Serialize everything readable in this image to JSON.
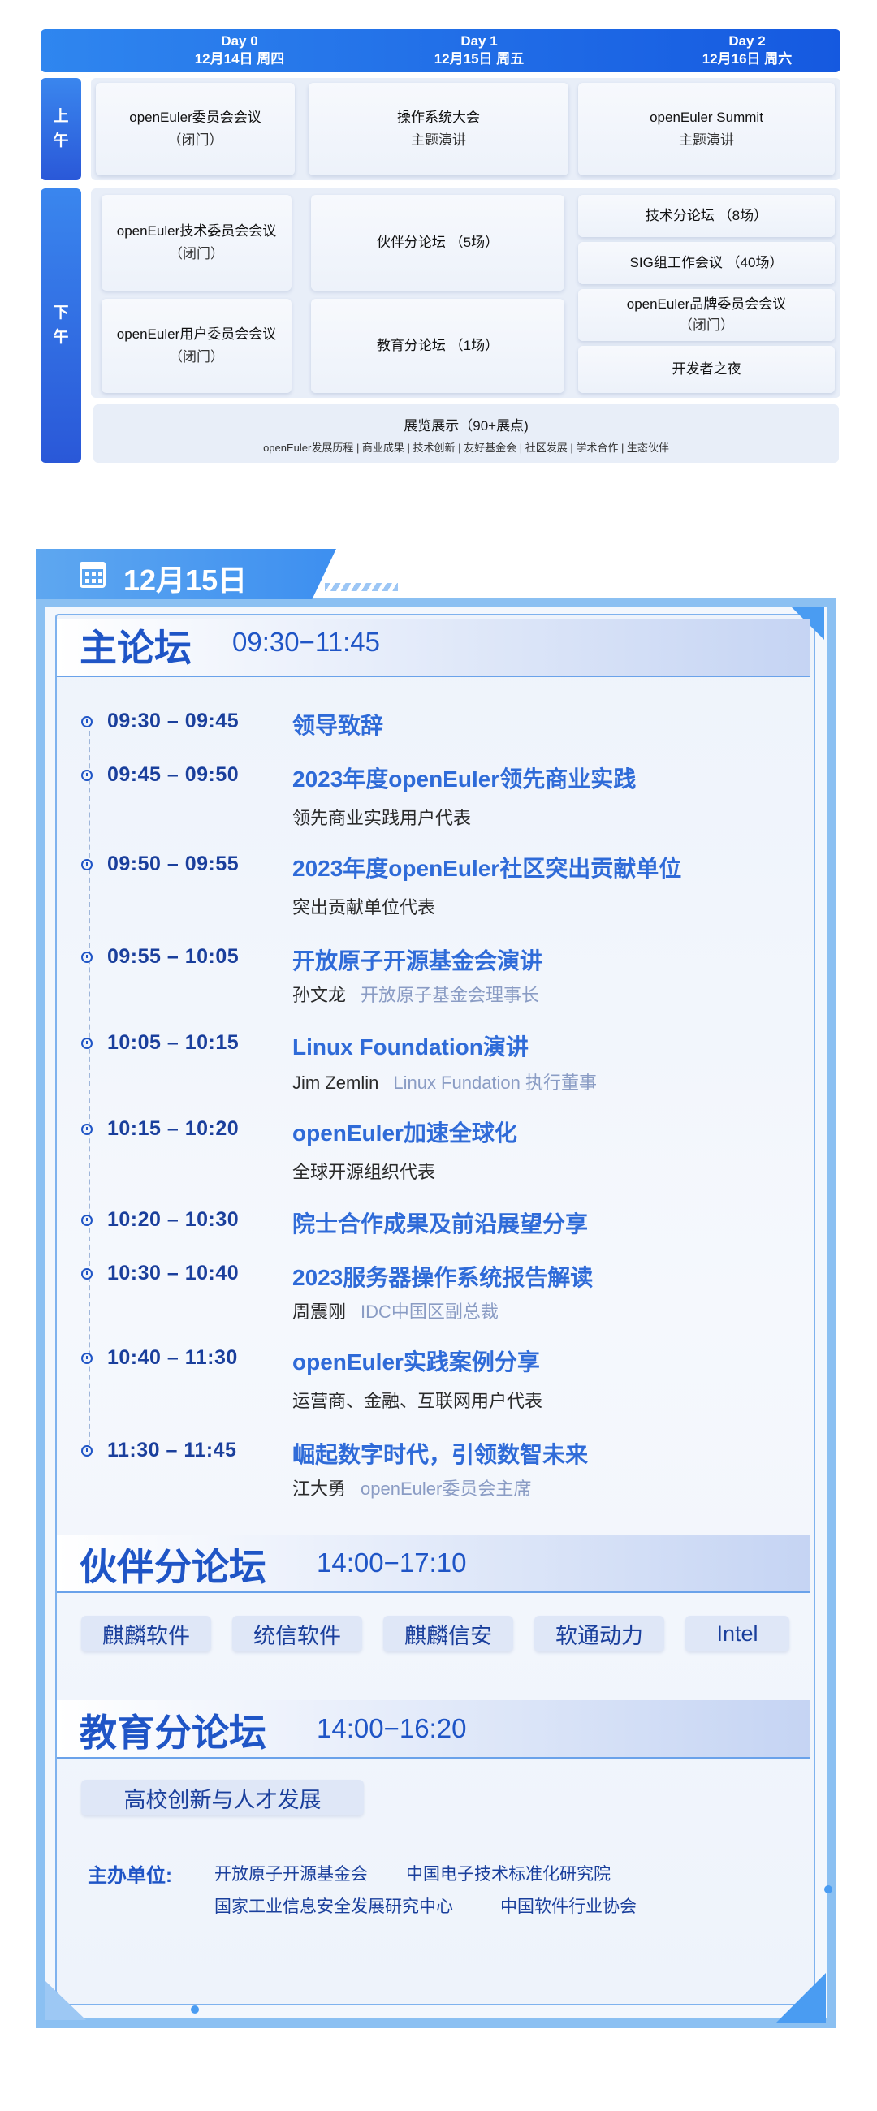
{
  "grid": {
    "days": [
      {
        "day": "Day 0",
        "date": "12月14日  周四"
      },
      {
        "day": "Day 1",
        "date": "12月15日  周五"
      },
      {
        "day": "Day 2",
        "date": "12月16日  周六"
      }
    ],
    "morning_label": "上\n午",
    "morning_label_chars": [
      "上",
      "午"
    ],
    "afternoon_label_chars": [
      "下",
      "午"
    ],
    "morning": [
      {
        "title": "openEuler委员会会议",
        "sub": "（闭门）"
      },
      {
        "title": "操作系统大会",
        "sub": "主题演讲"
      },
      {
        "title": "openEuler Summit",
        "sub": "主题演讲"
      }
    ],
    "afternoon_day0": [
      {
        "title": "openEuler技术委员会会议",
        "sub": "（闭门）"
      },
      {
        "title": "openEuler用户委员会会议",
        "sub": "（闭门）"
      }
    ],
    "afternoon_day1": [
      {
        "title": "伙伴分论坛 （5场）"
      },
      {
        "title": "教育分论坛 （1场）"
      }
    ],
    "afternoon_day2": [
      {
        "title": "技术分论坛 （8场）"
      },
      {
        "title": "SIG组工作会议 （40场）"
      },
      {
        "title": "openEuler品牌委员会会议",
        "sub": "（闭门）"
      },
      {
        "title": "开发者之夜"
      }
    ],
    "expo": {
      "title": "展览展示（90+展点)",
      "items": "openEuler发展历程 | 商业成果 | 技术创新 | 友好基金会 | 社区发展 | 学术合作 | 生态伙伴"
    }
  },
  "agenda": {
    "date": "12月15日",
    "main_forum": {
      "title": "主论坛",
      "time": "09:30−11:45"
    },
    "items": [
      {
        "time": "09:30 – 09:45",
        "title": "领导致辞",
        "speaker": "",
        "role": ""
      },
      {
        "time": "09:45 – 09:50",
        "title": "2023年度openEuler领先商业实践",
        "speaker": "领先商业实践用户代表",
        "role": ""
      },
      {
        "time": "09:50 – 09:55",
        "title": "2023年度openEuler社区突出贡献单位",
        "speaker": "突出贡献单位代表",
        "role": ""
      },
      {
        "time": "09:55 – 10:05",
        "title": "开放原子开源基金会演讲",
        "speaker": "孙文龙",
        "role": "开放原子基金会理事长"
      },
      {
        "time": "10:05 – 10:15",
        "title": "Linux Foundation演讲",
        "speaker": "Jim Zemlin",
        "role": "Linux Fundation 执行董事"
      },
      {
        "time": "10:15 – 10:20",
        "title": "openEuler加速全球化",
        "speaker": "全球开源组织代表",
        "role": ""
      },
      {
        "time": "10:20 – 10:30",
        "title": "院士合作成果及前沿展望分享",
        "speaker": "",
        "role": ""
      },
      {
        "time": "10:30 – 10:40",
        "title": "2023服务器操作系统报告解读",
        "speaker": "周震刚",
        "role": "IDC中国区副总裁"
      },
      {
        "time": "10:40 – 11:30",
        "title": "openEuler实践案例分享",
        "speaker": "运营商、金融、互联网用户代表",
        "role": ""
      },
      {
        "time": "11:30 – 11:45",
        "title": "崛起数字时代，引领数智未来",
        "speaker": "江大勇",
        "role": "openEuler委员会主席"
      }
    ],
    "partner_forum": {
      "title": "伙伴分论坛",
      "time": "14:00−17:10",
      "partners": [
        "麒麟软件",
        "统信软件",
        "麒麟信安",
        "软通动力",
        "Intel"
      ]
    },
    "edu_forum": {
      "title": "教育分论坛",
      "time": "14:00−16:20",
      "topics": [
        "高校创新与人才发展"
      ]
    },
    "organizers": {
      "label": "主办单位:",
      "list": [
        "开放原子开源基金会",
        "中国电子技术标准化研究院",
        "国家工业信息安全发展研究中心",
        "中国软件行业协会"
      ]
    }
  },
  "colors": {
    "primary": "#1f55c6",
    "header_blue": "#1559e0",
    "frame": "#8bc0f2"
  },
  "icons": [
    "calendar-icon",
    "clock-icon"
  ]
}
